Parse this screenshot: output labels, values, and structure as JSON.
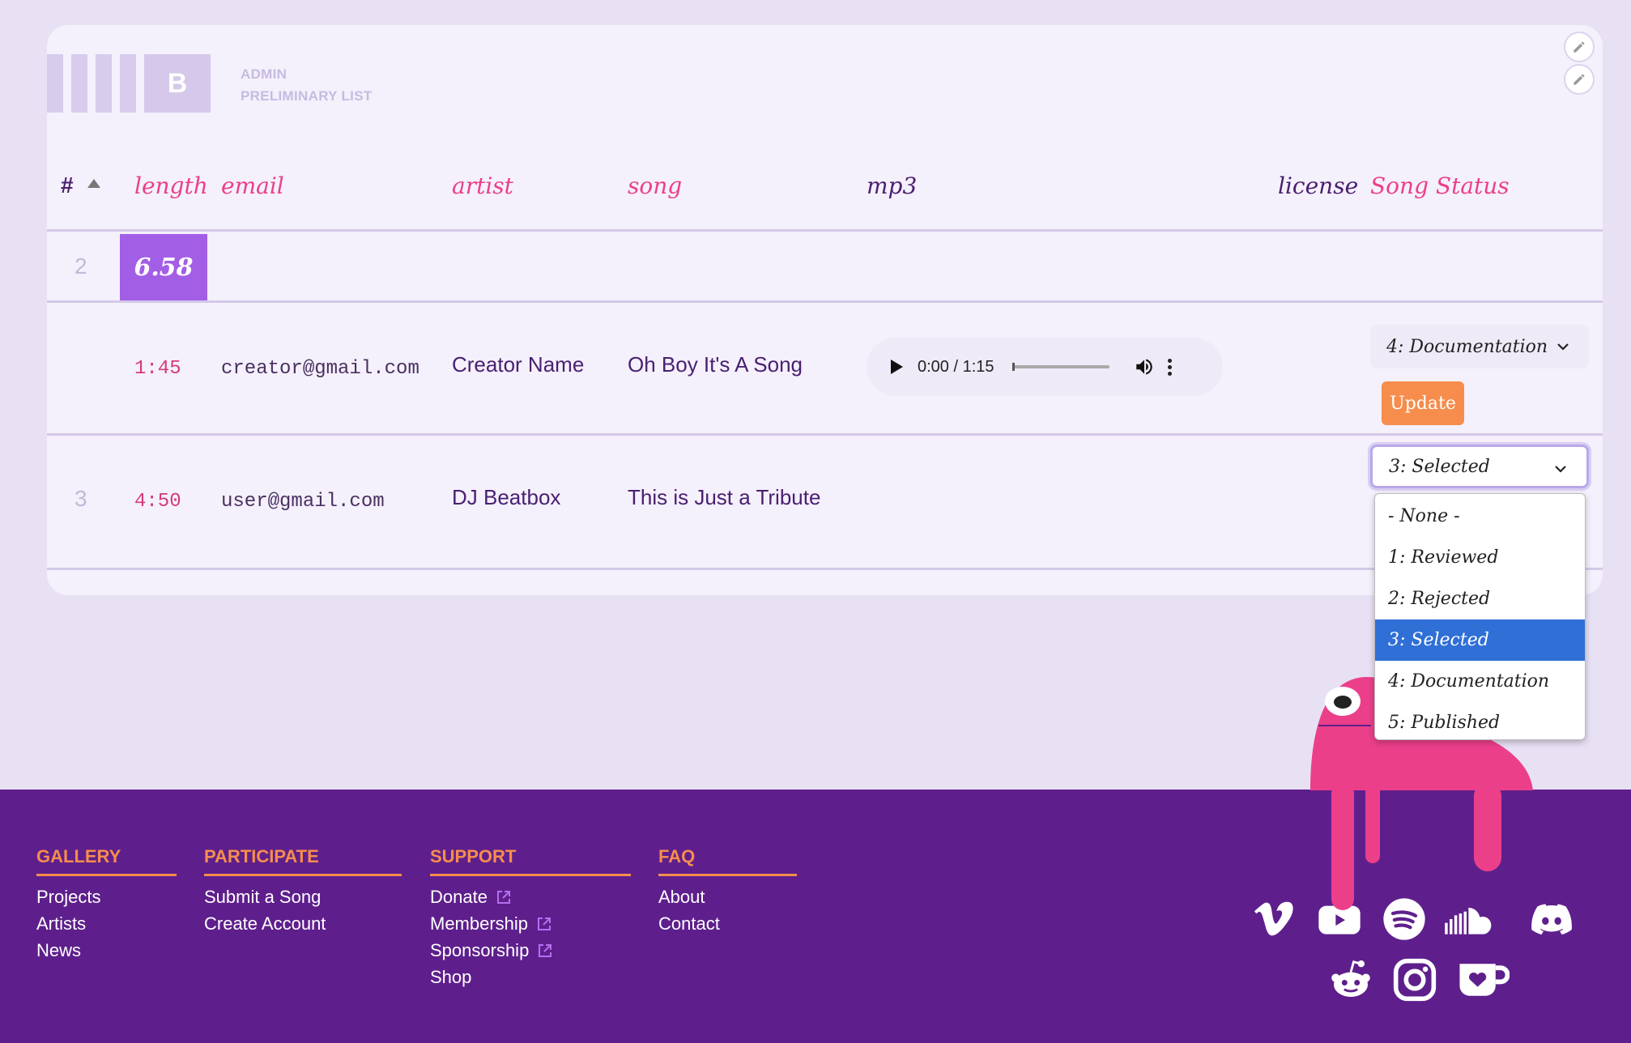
{
  "header": {
    "logo_letter": "B",
    "crumb_1": "ADMIN",
    "crumb_2": "PRELIMINARY LIST"
  },
  "table": {
    "columns": {
      "num": "#",
      "length": "length",
      "email": "email",
      "artist": "artist",
      "song": "song",
      "mp3": "mp3",
      "license": "license",
      "status": "Song Status"
    },
    "group": {
      "num": "2",
      "total_length": "6.58"
    },
    "rows": [
      {
        "num": "",
        "length": "1:45",
        "email": "creator@gmail.com",
        "artist": "Creator Name",
        "song": "Oh Boy It's A Song",
        "audio_time": "0:00 / 1:15",
        "status": "4: Documentation",
        "update_label": "Update"
      },
      {
        "num": "3",
        "length": "4:50",
        "email": "user@gmail.com",
        "artist": "DJ Beatbox",
        "song": "This is Just a Tribute",
        "status": "3: Selected"
      }
    ]
  },
  "status_options": [
    "- None -",
    "1: Reviewed",
    "2: Rejected",
    "3: Selected",
    "4: Documentation",
    "5: Published"
  ],
  "status_selected": "3: Selected",
  "footer": {
    "gallery": {
      "title": "GALLERY",
      "links": [
        "Projects",
        "Artists",
        "News"
      ]
    },
    "participate": {
      "title": "PARTICIPATE",
      "links": [
        "Submit a Song",
        "Create Account"
      ]
    },
    "support": {
      "title": "SUPPORT",
      "links": [
        "Donate",
        "Membership",
        "Sponsorship",
        "Shop"
      ]
    },
    "faq": {
      "title": "FAQ",
      "links": [
        "About",
        "Contact"
      ]
    }
  },
  "social_icons": [
    "vimeo-icon",
    "youtube-icon",
    "spotify-icon",
    "soundcloud-icon",
    "discord-icon",
    "reddit-icon",
    "instagram-icon",
    "kofi-icon"
  ],
  "colors": {
    "background": "#e8e1f4",
    "card": "#f4f0fc",
    "accent_pink": "#ec3f8a",
    "accent_purple": "#a35ee6",
    "footer": "#5e1f8c",
    "orange": "#f68d4d",
    "selected_option": "#2f6fd6"
  }
}
